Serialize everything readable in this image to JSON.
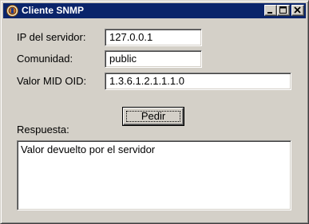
{
  "window": {
    "title": "Cliente SNMP",
    "controls": {
      "minimize": "minimize-icon",
      "maximize": "maximize-icon",
      "close": "close-icon"
    }
  },
  "form": {
    "ip_label": "IP del servidor:",
    "ip_value": "127.0.0.1",
    "community_label": "Comunidad:",
    "community_value": "public",
    "oid_label": "Valor MID OID:",
    "oid_value": "1.3.6.1.2.1.1.1.0"
  },
  "actions": {
    "request_label": "Pedir"
  },
  "response": {
    "label": "Respuesta:",
    "text": "Valor devuelto por el servidor"
  },
  "colors": {
    "titlebar": "#0a246a",
    "window_face": "#d4d0c8",
    "field_background": "#ffffff"
  }
}
